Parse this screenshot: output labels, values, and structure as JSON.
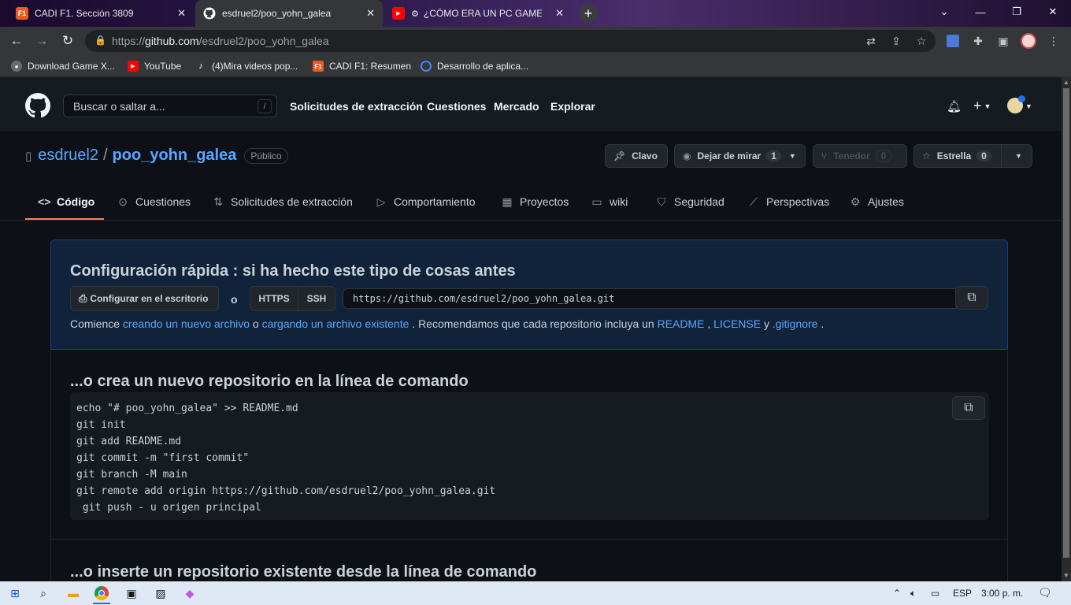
{
  "browser": {
    "tabs": [
      {
        "title": "CADI F1. Sección 3809",
        "favicon": "F1",
        "favicon_color": "#e85a1e"
      },
      {
        "title": "esdruel2/poo_yohn_galea",
        "favicon": "github-icon",
        "favicon_color": "#ffffff"
      },
      {
        "title": "¿CÓMO ERA UN PC GAMER",
        "favicon": "youtube-icon",
        "favicon_color": "#ff0000"
      }
    ],
    "new_tab": "+",
    "url_scheme": "https://",
    "url_host": "github.com",
    "url_path": "/esdruel2/poo_yohn_galea",
    "bookmarks": [
      {
        "label": "Download Game X...",
        "icon": "globe-icon"
      },
      {
        "label": "YouTube",
        "icon": "youtube-icon"
      },
      {
        "label": "(4)Mira videos pop...",
        "icon": "tiktok-icon"
      },
      {
        "label": "CADI F1: Resumen",
        "icon": "F1"
      },
      {
        "label": "Desarrollo de aplica...",
        "icon": "circle-icon"
      }
    ]
  },
  "github": {
    "search_placeholder": "Buscar o saltar a...",
    "search_shortcut": "/",
    "nav": [
      "Solicitudes de extracción",
      "Cuestiones",
      "Mercado",
      "Explorar"
    ],
    "plus": "+"
  },
  "repo": {
    "owner": "esdruel2",
    "separator": "/",
    "name": "poo_yohn_galea",
    "visibility": "Público",
    "pin_label": "Clavo",
    "watch_label": "Dejar de mirar",
    "watch_count": "1",
    "fork_label": "Tenedor",
    "fork_count": "0",
    "star_label": "Estrella",
    "star_count": "0",
    "tabs": [
      {
        "label": "Código",
        "icon": "code-icon"
      },
      {
        "label": "Cuestiones",
        "icon": "issue-icon"
      },
      {
        "label": "Solicitudes de extracción",
        "icon": "pull-request-icon"
      },
      {
        "label": "Comportamiento",
        "icon": "play-icon"
      },
      {
        "label": "Proyectos",
        "icon": "table-icon"
      },
      {
        "label": "wiki",
        "icon": "book-icon"
      },
      {
        "label": "Seguridad",
        "icon": "shield-icon"
      },
      {
        "label": "Perspectivas",
        "icon": "graph-icon"
      },
      {
        "label": "Ajustes",
        "icon": "gear-icon"
      }
    ]
  },
  "quick_setup": {
    "title": "Configuración rápida : si ha hecho este tipo de cosas antes",
    "desktop_button": "Configurar en el escritorio",
    "or": "o",
    "https": "HTTPS",
    "ssh": "SSH",
    "clone_url": "https://github.com/esdruel2/poo_yohn_galea.git",
    "hint_start": "Comience ",
    "hint_link1": "creando un nuevo archivo",
    "hint_mid1": " o ",
    "hint_link2": "cargando un archivo existente",
    "hint_mid2": " . Recomendamos que cada repositorio incluya un ",
    "hint_link3": "README",
    "hint_mid3": " , ",
    "hint_link4": "LICENSE",
    "hint_mid4": " y ",
    "hint_link5": ".gitignore",
    "hint_end": " ."
  },
  "new_repo": {
    "title": "...o crea un nuevo repositorio en la línea de comando",
    "code": "echo \"# poo_yohn_galea\" >> README.md\ngit init\ngit add README.md\ngit commit -m \"first commit\"\ngit branch -M main\ngit remote add origin https://github.com/esdruel2/poo_yohn_galea.git\n git push - u origen principal"
  },
  "existing_repo": {
    "title": "...o inserte un repositorio existente desde la línea de comando"
  },
  "taskbar": {
    "language": "ESP",
    "time": "3:00 p. m."
  }
}
